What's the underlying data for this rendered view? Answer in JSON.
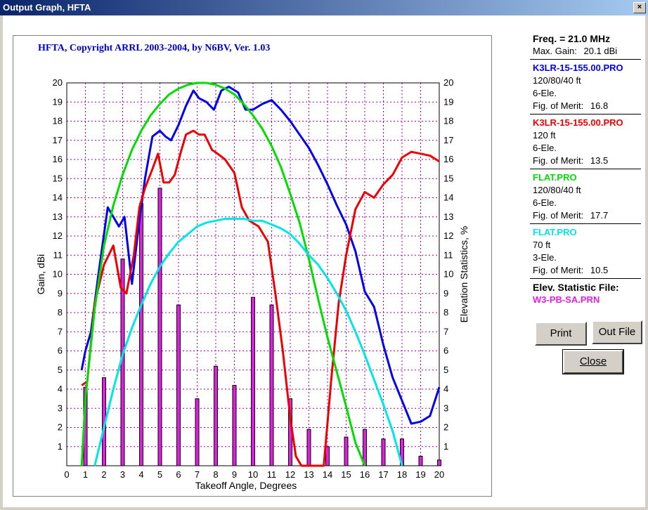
{
  "window": {
    "title": "Output Graph, HFTA"
  },
  "plot": {
    "copyright": "HFTA, Copyright ARRL 2003-2004, by N6BV, Ver. 1.03"
  },
  "panel": {
    "freq": "Freq. = 21.0 MHz",
    "max_gain_label": "Max. Gain:",
    "max_gain_value": "20.1 dBi",
    "antennas": [
      {
        "name": "K3LR-15-155.00.PRO",
        "color": "#0000ee",
        "height": "120/80/40 ft",
        "elements": "6-Ele.",
        "merit_label": "Fig. of Merit:",
        "merit_value": "16.8"
      },
      {
        "name": "K3LR-15-155.00.PRO",
        "color": "#ee0000",
        "height": "120 ft",
        "elements": "6-Ele.",
        "merit_label": "Fig. of Merit:",
        "merit_value": "13.5"
      },
      {
        "name": "FLAT.PRO",
        "color": "#00dd00",
        "height": "120/80/40 ft",
        "elements": "6-Ele.",
        "merit_label": "Fig. of Merit:",
        "merit_value": "17.7"
      },
      {
        "name": "FLAT.PRO",
        "color": "#00e5e5",
        "height": "70 ft",
        "elements": "3-Ele.",
        "merit_label": "Fig. of Merit:",
        "merit_value": "10.5"
      }
    ],
    "elev_label": "Elev. Statistic File:",
    "elev_file": "W3-PB-SA.PRN"
  },
  "buttons": {
    "print": "Print",
    "outfile": "Out File",
    "close": "Close"
  },
  "chart_data": {
    "type": "line",
    "xlabel": "Takeoff Angle, Degrees",
    "ylabel": "Gain, dBi",
    "y2label": "Elevation Statistics, %",
    "xlim": [
      0,
      20
    ],
    "ylim": [
      0,
      20
    ],
    "y2lim": [
      0,
      20
    ],
    "x_ticks": [
      0,
      1,
      2,
      3,
      4,
      5,
      6,
      7,
      8,
      9,
      10,
      11,
      12,
      13,
      14,
      15,
      16,
      17,
      18,
      19,
      20
    ],
    "y_ticks": [
      1,
      2,
      3,
      4,
      5,
      6,
      7,
      8,
      9,
      10,
      11,
      12,
      13,
      14,
      15,
      16,
      17,
      18,
      19,
      20
    ],
    "grid": true,
    "series": [
      {
        "color": "#0000ee",
        "x": [
          0.8,
          1,
          1.3,
          1.7,
          2.2,
          2.5,
          2.8,
          3.1,
          3.5,
          3.8,
          4.2,
          4.6,
          5,
          5.3,
          5.6,
          6,
          6.4,
          6.8,
          7.1,
          7.5,
          7.9,
          8.3,
          8.7,
          9.2,
          9.6,
          10,
          10.5,
          11,
          11.5,
          12,
          12.5,
          13,
          13.5,
          14,
          14.5,
          15,
          15.5,
          16,
          16.5,
          17,
          17.5,
          18,
          18.5,
          19,
          19.5,
          20
        ],
        "y": [
          5,
          6,
          7,
          10,
          13.5,
          13,
          12.5,
          13,
          9.5,
          12,
          15,
          17.2,
          17.5,
          17.2,
          17,
          17.8,
          18.8,
          19.6,
          19.2,
          19,
          18.6,
          19.6,
          19.8,
          19.5,
          18.6,
          18.6,
          18.9,
          19.1,
          18.6,
          18,
          17.3,
          16.6,
          15.7,
          14.7,
          13.6,
          12.6,
          11.2,
          9.1,
          8.3,
          6.3,
          4.6,
          3.4,
          2.2,
          2.3,
          2.6,
          4.1
        ]
      },
      {
        "color": "#ee0000",
        "x": [
          0.8,
          1.1,
          1.5,
          2,
          2.5,
          2.9,
          3.2,
          3.6,
          3.9,
          4.2,
          4.6,
          4.9,
          5.2,
          5.5,
          5.8,
          6.1,
          6.4,
          6.8,
          7.1,
          7.4,
          7.8,
          8.1,
          8.5,
          9,
          9.4,
          9.8,
          10.3,
          10.8,
          11.2,
          11.6,
          12,
          12.3,
          12.6,
          13.8,
          14.2,
          14.6,
          15,
          15.5,
          16,
          16.5,
          17,
          17.5,
          18,
          18.5,
          19,
          19.5,
          20
        ],
        "y": [
          4.2,
          4.4,
          8.5,
          10.5,
          11.5,
          9.3,
          9.0,
          11,
          13.5,
          14.5,
          15.5,
          16.3,
          14.8,
          14.8,
          15.2,
          16.3,
          17.3,
          17.5,
          17.3,
          17.3,
          16.5,
          16.3,
          16.0,
          15.3,
          13.5,
          12.8,
          12.5,
          11.7,
          9,
          6,
          2.5,
          0.5,
          0,
          0,
          4.5,
          8.5,
          11,
          13.4,
          14.3,
          14.0,
          14.7,
          15.2,
          16.1,
          16.4,
          16.3,
          16.2,
          15.9
        ]
      },
      {
        "color": "#00dd00",
        "x": [
          0.8,
          1,
          1.5,
          2,
          2.5,
          3,
          3.5,
          4,
          4.5,
          5,
          5.5,
          6,
          6.5,
          7,
          7.5,
          8,
          8.5,
          9,
          9.5,
          10,
          10.5,
          11,
          11.5,
          12,
          12.5,
          13,
          13.5,
          14,
          14.5,
          15,
          15.5,
          16
        ],
        "y": [
          0,
          3.5,
          8.2,
          11.5,
          13.6,
          15.2,
          16.5,
          17.5,
          18.3,
          18.9,
          19.4,
          19.7,
          19.9,
          20,
          20,
          19.9,
          19.7,
          19.4,
          18.9,
          18.3,
          17.6,
          16.7,
          15.6,
          14.2,
          12.7,
          10.8,
          8.7,
          6.7,
          4.9,
          3.1,
          1.2,
          0
        ]
      },
      {
        "color": "#00e5e5",
        "x": [
          1.5,
          2,
          2.5,
          3,
          3.5,
          4,
          4.5,
          5,
          5.5,
          6,
          6.5,
          7,
          7.5,
          8,
          8.5,
          9,
          9.5,
          10,
          10.5,
          11,
          11.5,
          12,
          12.5,
          13,
          13.5,
          14,
          14.5,
          15,
          15.5,
          16,
          16.5,
          17,
          17.5,
          18
        ],
        "y": [
          0,
          2,
          4,
          5.8,
          7.2,
          8.4,
          9.5,
          10.4,
          11.1,
          11.7,
          12.1,
          12.5,
          12.7,
          12.8,
          12.9,
          12.9,
          12.9,
          12.8,
          12.8,
          12.6,
          12.4,
          12.1,
          11.6,
          11.0,
          10.5,
          9.8,
          9.0,
          8.1,
          7.0,
          5.8,
          4.5,
          3.2,
          1.8,
          0
        ]
      }
    ],
    "bars": {
      "color": "#e020e0",
      "x": [
        1,
        2,
        3,
        4,
        5,
        6,
        7,
        8,
        9,
        10,
        11,
        12,
        13,
        14,
        15,
        16,
        17,
        18,
        19,
        20
      ],
      "values": [
        4.1,
        4.6,
        10.8,
        13.7,
        14.5,
        8.4,
        3.5,
        5.2,
        4.2,
        8.8,
        8.4,
        3.5,
        1.9,
        1.0,
        1.5,
        1.9,
        1.4,
        1.4,
        0.5,
        0.3
      ]
    }
  }
}
